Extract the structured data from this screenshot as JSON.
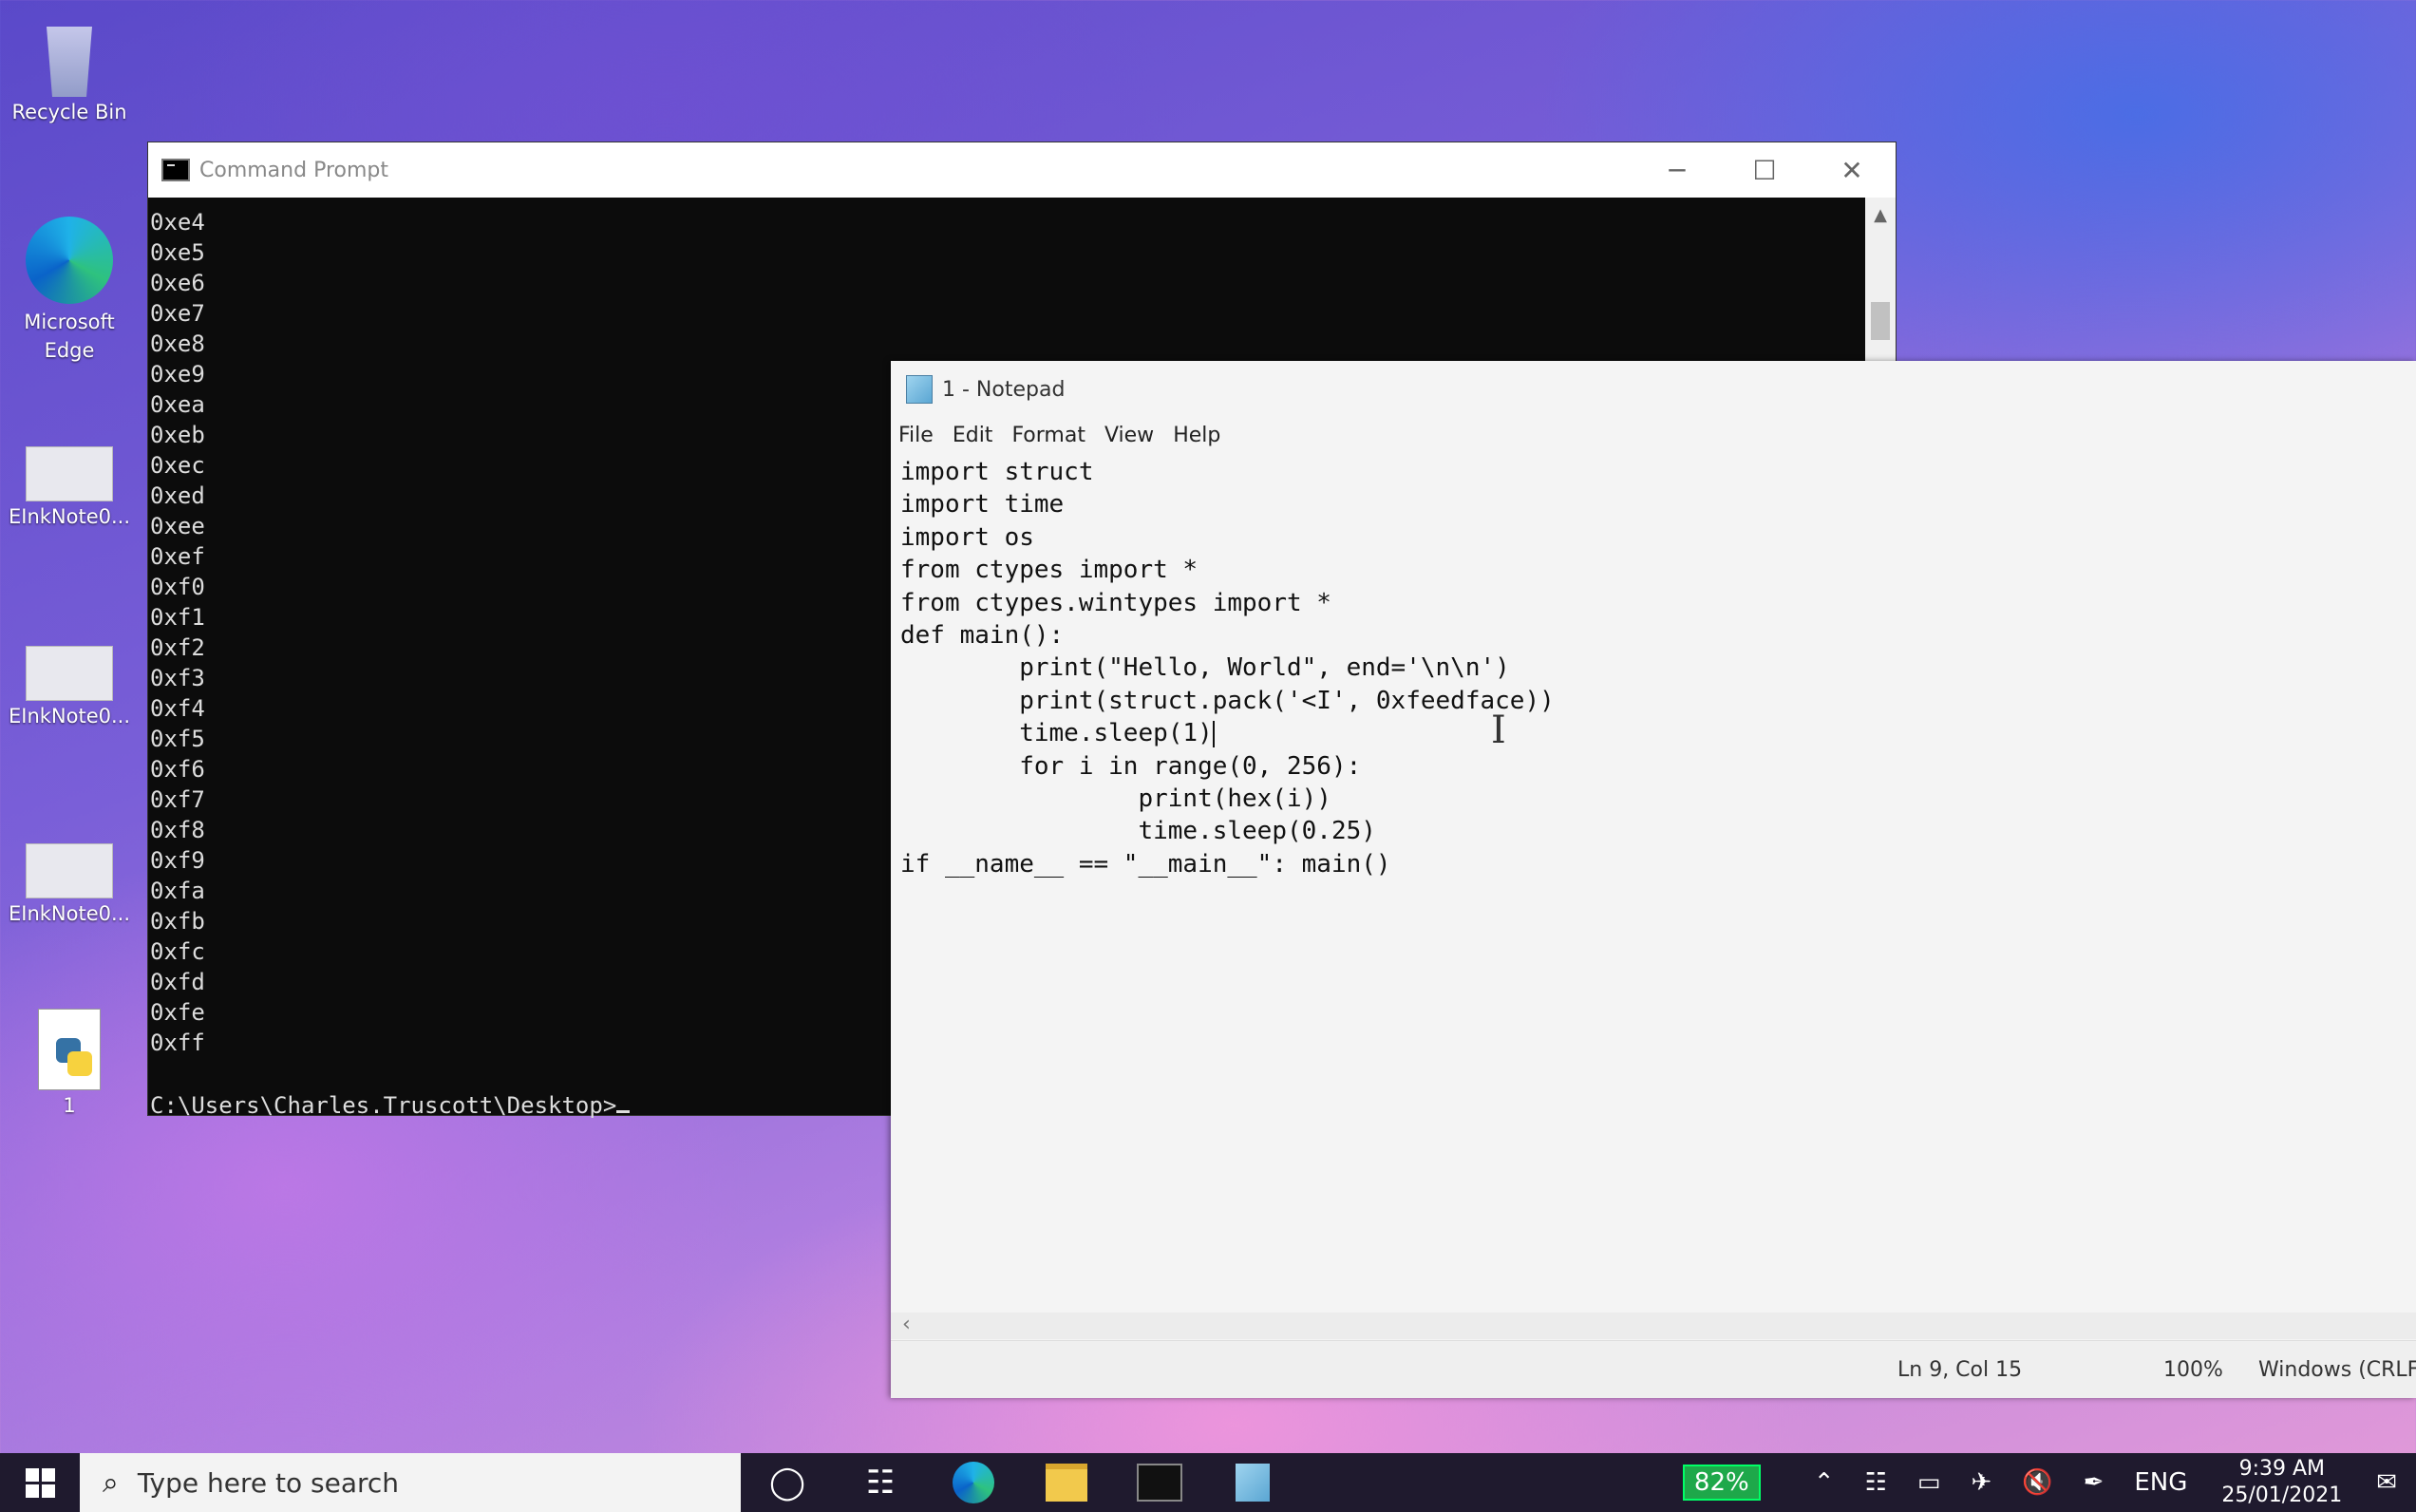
{
  "desktop": {
    "icons": [
      {
        "label": "Recycle Bin",
        "icon": "recycle-bin-icon"
      },
      {
        "label": "Microsoft Edge",
        "icon": "edge-icon"
      },
      {
        "label": "EInkNote0...",
        "icon": "image-file-icon"
      },
      {
        "label": "EInkNote0...",
        "icon": "image-file-icon"
      },
      {
        "label": "EInkNote0...",
        "icon": "image-file-icon"
      },
      {
        "label": "1",
        "icon": "python-file-icon"
      }
    ]
  },
  "cmd": {
    "title": "Command Prompt",
    "output": [
      "0xe4",
      "0xe5",
      "0xe6",
      "0xe7",
      "0xe8",
      "0xe9",
      "0xea",
      "0xeb",
      "0xec",
      "0xed",
      "0xee",
      "0xef",
      "0xf0",
      "0xf1",
      "0xf2",
      "0xf3",
      "0xf4",
      "0xf5",
      "0xf6",
      "0xf7",
      "0xf8",
      "0xf9",
      "0xfa",
      "0xfb",
      "0xfc",
      "0xfd",
      "0xfe",
      "0xff"
    ],
    "prompt": "C:\\Users\\Charles.Truscott\\Desktop>"
  },
  "notepad": {
    "title": "1 - Notepad",
    "menu": [
      "File",
      "Edit",
      "Format",
      "View",
      "Help"
    ],
    "lines": [
      "import struct",
      "import time",
      "import os",
      "from ctypes import *",
      "from ctypes.wintypes import *",
      "def main():",
      "        print(\"Hello, World\", end='\\n\\n')",
      "        print(struct.pack('<I', 0xfeedface))",
      "        time.sleep(1)",
      "        for i in range(0, 256):",
      "                print(hex(i))",
      "                time.sleep(0.25)",
      "if __name__ == \"__main__\": main()"
    ],
    "status": {
      "position": "Ln 9, Col 15",
      "zoom": "100%",
      "eol": "Windows (CRLF)"
    }
  },
  "taskbar": {
    "search_placeholder": "Type here to search",
    "battery": "82%",
    "language": "ENG",
    "time": "9:39 AM",
    "date": "25/01/2021"
  }
}
